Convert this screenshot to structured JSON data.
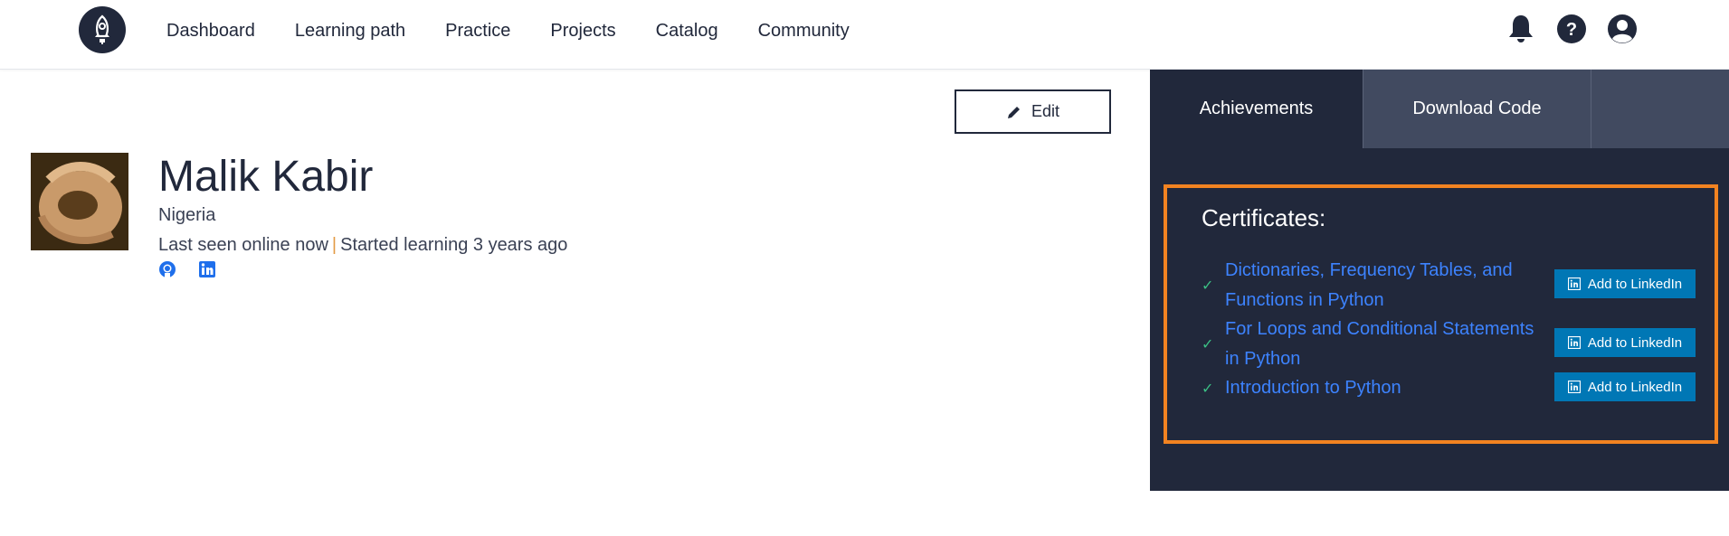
{
  "nav": {
    "items": [
      {
        "label": "Dashboard"
      },
      {
        "label": "Learning path"
      },
      {
        "label": "Practice"
      },
      {
        "label": "Projects"
      },
      {
        "label": "Catalog"
      },
      {
        "label": "Community"
      }
    ]
  },
  "profile": {
    "edit_label": "Edit",
    "name": "Malik Kabir",
    "country": "Nigeria",
    "last_seen": "Last seen online now",
    "separator": "|",
    "started": "Started learning 3 years ago"
  },
  "panel": {
    "tabs": [
      {
        "label": "Achievements"
      },
      {
        "label": "Download Code"
      }
    ],
    "certificates_title": "Certificates:",
    "certificates": [
      {
        "line1": "Dictionaries, Frequency Tables, and",
        "line2": "Functions in Python",
        "button": "Add to LinkedIn"
      },
      {
        "line1": "For Loops and Conditional Statements",
        "line2": "in Python",
        "button": "Add to LinkedIn"
      },
      {
        "line1": "Introduction to Python",
        "line2": "",
        "button": "Add to LinkedIn"
      }
    ]
  },
  "colors": {
    "navy": "#21283b",
    "highlight": "#f28321",
    "link": "#3d83ff",
    "linkedin": "#0077b5",
    "check": "#3bbf84"
  }
}
